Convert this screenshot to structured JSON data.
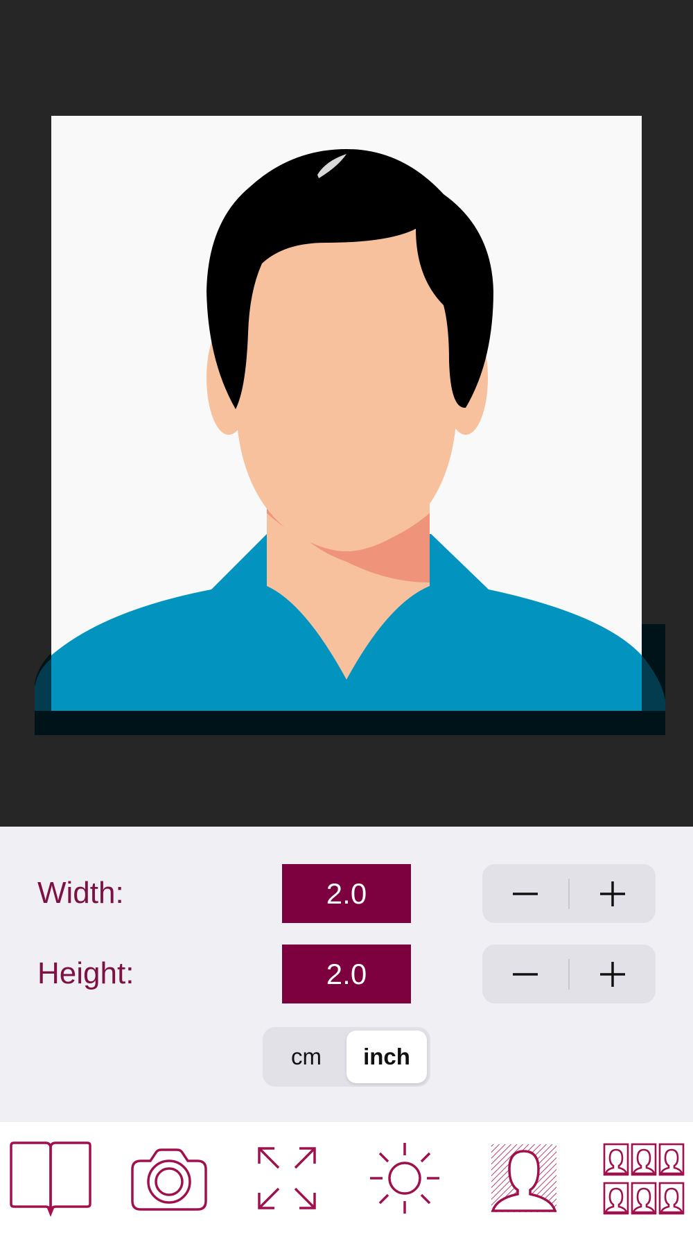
{
  "photo_preview": {
    "background_color": "#262626",
    "photo_background": "#f9f9fa",
    "shirt_color": "#0393bf",
    "skin_color": "#f6c19c",
    "hair_color": "#000000"
  },
  "size_controls": {
    "width_label": "Width:",
    "width_value": "2.0",
    "height_label": "Height:",
    "height_value": "2.0",
    "decrement_symbol": "−",
    "increment_symbol": "+"
  },
  "unit_selector": {
    "options": [
      "cm",
      "inch"
    ],
    "selected": "inch"
  },
  "tab_bar": {
    "accent_color": "#a0104d",
    "items": [
      {
        "icon": "book-icon"
      },
      {
        "icon": "camera-icon"
      },
      {
        "icon": "expand-arrows-icon"
      },
      {
        "icon": "brightness-icon"
      },
      {
        "icon": "portrait-background-icon"
      },
      {
        "icon": "photo-grid-icon"
      }
    ]
  }
}
